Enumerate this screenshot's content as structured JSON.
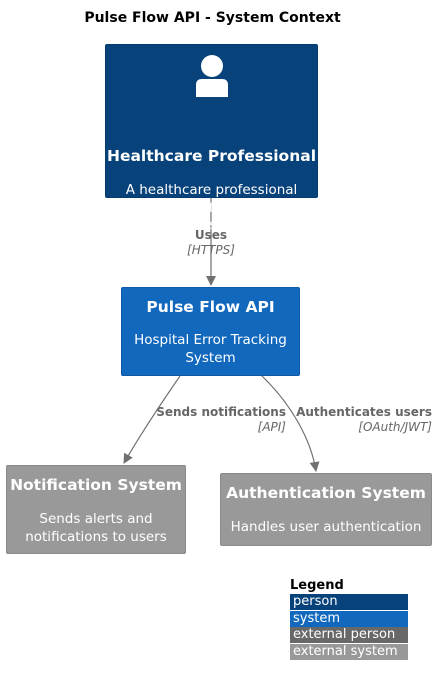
{
  "title": "Pulse Flow API - System Context",
  "nodes": {
    "person": {
      "name": "Healthcare Professional",
      "description": "A healthcare professional that needs to track and manage hospital errors",
      "color": "#08427b",
      "icon": "person-icon"
    },
    "api": {
      "name": "Pulse Flow API",
      "description": "Hospital Error Tracking System",
      "color": "#1168bd"
    },
    "notification": {
      "name": "Notification System",
      "description": "Sends alerts and notifications to users",
      "color": "#999999"
    },
    "auth": {
      "name": "Authentication System",
      "description": "Handles user authentication",
      "color": "#999999"
    }
  },
  "edges": {
    "uses": {
      "label": "Uses",
      "tech": "[HTTPS]"
    },
    "notify": {
      "label": "Sends notifications",
      "tech": "[API]"
    },
    "authenticate": {
      "label": "Authenticates users",
      "tech": "[OAuth/JWT]"
    }
  },
  "legend": {
    "title": "Legend",
    "items": [
      {
        "label": "person",
        "color": "#08427b"
      },
      {
        "label": "system",
        "color": "#1168bd"
      },
      {
        "label": "external person",
        "color": "#686868"
      },
      {
        "label": "external system",
        "color": "#999999"
      }
    ]
  }
}
